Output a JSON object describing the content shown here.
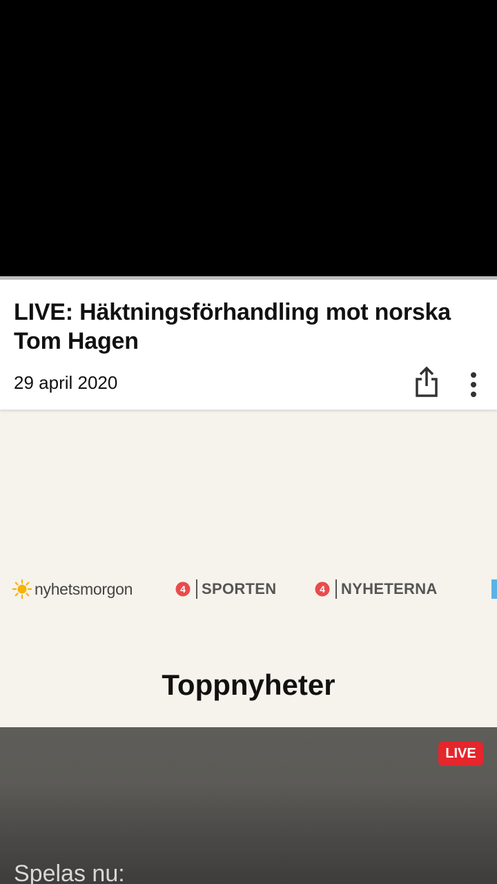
{
  "video": {
    "title": "LIVE: Häktningsförhandling mot norska Tom Hagen",
    "date": "29 april 2020"
  },
  "actions": {
    "share_icon": "share-icon",
    "more_icon": "more-vertical-icon"
  },
  "channels": [
    {
      "name": "nyhetsmorgon",
      "icon": "sun-icon",
      "color": "#f5b400"
    },
    {
      "name": "SPORTEN",
      "icon": "tv4-logo",
      "color": "#e84c4c"
    },
    {
      "name": "NYHETERNA",
      "icon": "tv4-logo",
      "color": "#e84c4c"
    }
  ],
  "section": {
    "heading": "Toppnyheter"
  },
  "news_card": {
    "badge": "LIVE",
    "badge_color": "#e5262c",
    "playing_label": "Spelas nu:"
  }
}
